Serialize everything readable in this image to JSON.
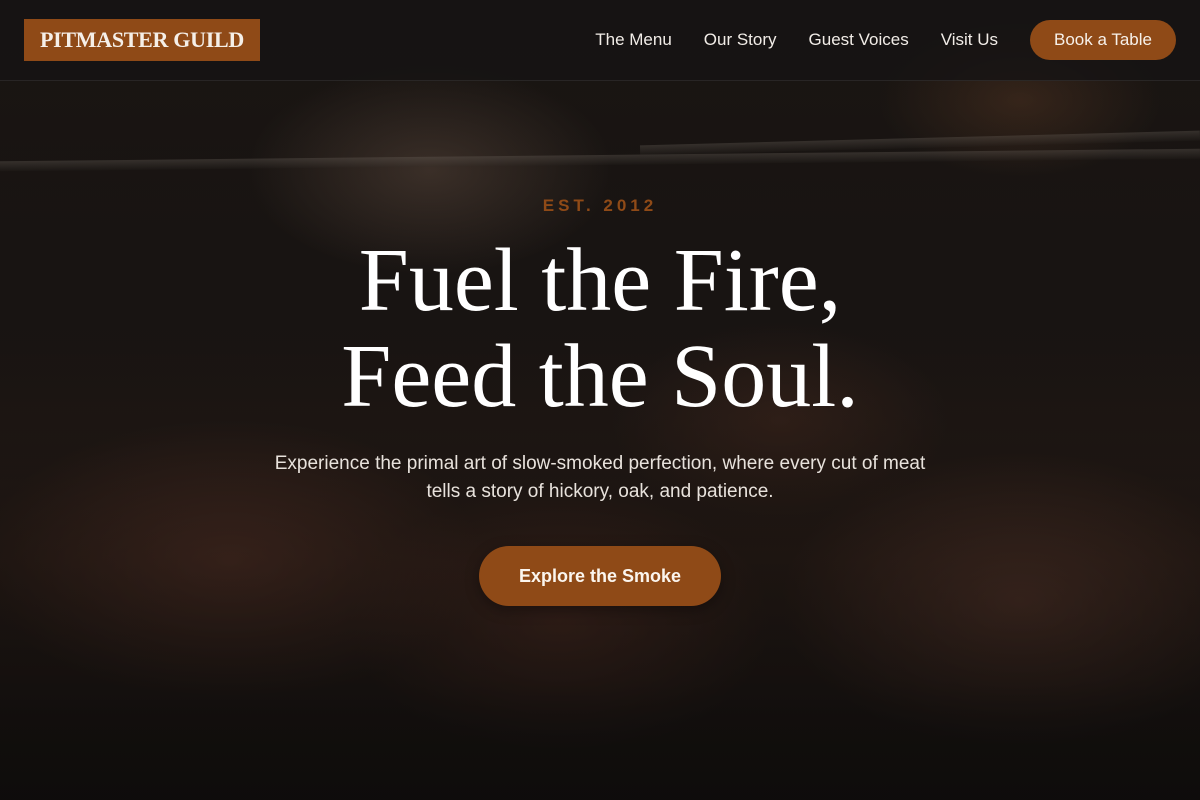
{
  "brand": {
    "logo_text": "PITMASTER GUILD",
    "accent_color": "#8f4a17"
  },
  "nav": {
    "links": [
      {
        "label": "The Menu"
      },
      {
        "label": "Our Story"
      },
      {
        "label": "Guest Voices"
      },
      {
        "label": "Visit Us"
      }
    ],
    "cta_label": "Book a Table"
  },
  "hero": {
    "eyebrow": "EST. 2012",
    "headline_line1": "Fuel the Fire,",
    "headline_line2": "Feed the Soul.",
    "subtext": "Experience the primal art of slow-smoked perfection, where every cut of meat tells a story of hickory, oak, and patience.",
    "cta_label": "Explore the Smoke"
  }
}
